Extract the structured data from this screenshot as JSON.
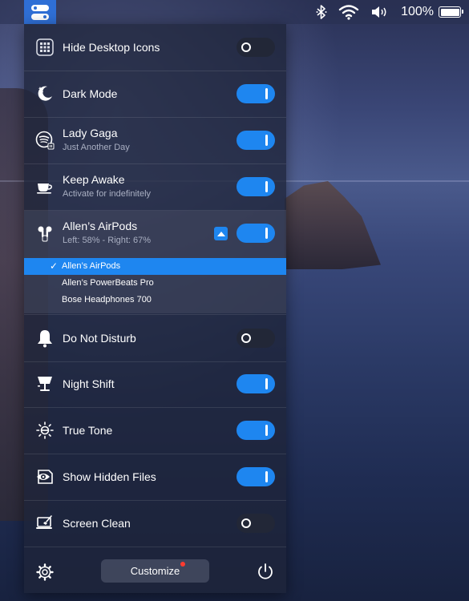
{
  "menubar": {
    "battery_percent": "100%",
    "status_icons": [
      "bluetooth-icon",
      "wifi-icon",
      "volume-icon",
      "battery-icon"
    ]
  },
  "panel": {
    "rows": [
      {
        "id": "hide-desktop-icons",
        "title": "Hide Desktop Icons",
        "subtitle": "",
        "icon": "desktop-grid-icon",
        "on": false
      },
      {
        "id": "dark-mode",
        "title": "Dark Mode",
        "subtitle": "",
        "icon": "moon-icon",
        "on": true
      },
      {
        "id": "lady-gaga",
        "title": "Lady Gaga",
        "subtitle": "Just Another Day",
        "icon": "spotify-icon",
        "on": true
      },
      {
        "id": "keep-awake",
        "title": "Keep Awake",
        "subtitle": "Activate for indefinitely",
        "icon": "coffee-cup-icon",
        "on": true
      },
      {
        "id": "airpods",
        "title": "Allen’s AirPods",
        "subtitle": "Left: 58% - Right: 67%",
        "icon": "airpods-icon",
        "on": true
      },
      {
        "id": "do-not-disturb",
        "title": "Do Not Disturb",
        "subtitle": "",
        "icon": "bell-icon",
        "on": false
      },
      {
        "id": "night-shift",
        "title": "Night Shift",
        "subtitle": "",
        "icon": "lamp-icon",
        "on": true
      },
      {
        "id": "true-tone",
        "title": "True Tone",
        "subtitle": "",
        "icon": "sun-icon",
        "on": true
      },
      {
        "id": "show-hidden-files",
        "title": "Show Hidden Files",
        "subtitle": "",
        "icon": "eye-icon",
        "on": true
      },
      {
        "id": "screen-clean",
        "title": "Screen Clean",
        "subtitle": "",
        "icon": "screen-brush-icon",
        "on": false
      }
    ],
    "devices": [
      {
        "name": "Allen’s AirPods",
        "selected": true
      },
      {
        "name": "Allen’s PowerBeats Pro",
        "selected": false
      },
      {
        "name": "Bose Headphones 700",
        "selected": false
      }
    ],
    "footer": {
      "customize_label": "Customize",
      "settings_icon": "gear-icon",
      "power_icon": "power-icon"
    }
  },
  "colors": {
    "accent": "#1e86f0",
    "toggle_off": "#222737",
    "badge": "#ff3b30"
  }
}
